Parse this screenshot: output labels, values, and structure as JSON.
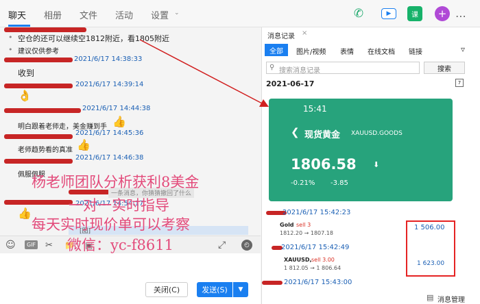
{
  "top_tabs": [
    "聊天",
    "相册",
    "文件",
    "活动",
    "设置"
  ],
  "chat": {
    "top_line1": "空仓的还可以继续空1812附近，看1805附近",
    "top_line2": "建议仅供参考",
    "messages": [
      {
        "ts": "2021/6/17 14:38:33",
        "text": "收到"
      },
      {
        "ts": "2021/6/17 14:39:14",
        "text": ""
      },
      {
        "ts": "2021/6/17 14:44:38",
        "text": "明白跟着老师走，美金赚到手"
      },
      {
        "ts": "2021/6/17 14:45:36",
        "text": "老师趋势看的真准"
      },
      {
        "ts": "2021/6/17 14:46:38",
        "text": "佩服佩服"
      }
    ],
    "recall_notice": "一条消息，你猜猜撤回了什么",
    "last_ts": "2021/6/17 14:54:17",
    "reply_box": "[图]"
  },
  "toolbar": {
    "gif": "GIF"
  },
  "buttons": {
    "close": "关闭(C)",
    "send": "发送(S)"
  },
  "side": {
    "title": "消息记录",
    "tabs": [
      "全部",
      "图片/视频",
      "表情",
      "在线文档",
      "链接"
    ],
    "search_placeholder": "搜索消息记录",
    "search_button": "搜索",
    "date": "2021-06-17",
    "card": {
      "time": "15:41",
      "name": "现货黄金",
      "symbol": "XAUUSD.GOODS",
      "price": "1806.58",
      "change_pct": "-0.21%",
      "change": "-3.85"
    },
    "ts1": "2021/6/17 15:42:23",
    "order1": {
      "title": "Gold",
      "action": "sell 3",
      "prices": "1812.20 → 1807.18",
      "profit": "1 506.00"
    },
    "ts2": "2021/6/17 15:42:49",
    "order2": {
      "title": "XAUUSD,",
      "action": "sell 3.00",
      "prices": "1 812.05 → 1 806.64",
      "profit": "1 623.00"
    },
    "ts3": "2021/6/17 15:43:00",
    "manage": "消息管理"
  },
  "overlay": {
    "line1": "杨老师团队分析获利8美金",
    "line2": "一对一实时指导",
    "line3": "每天实时现价单可以考察",
    "line4": "微信：yc-f8611"
  },
  "colors": {
    "accent": "#1a7ff0",
    "card_green": "#27a37c",
    "overlay_pink": "#e24a7a",
    "redline": "#c72525"
  }
}
